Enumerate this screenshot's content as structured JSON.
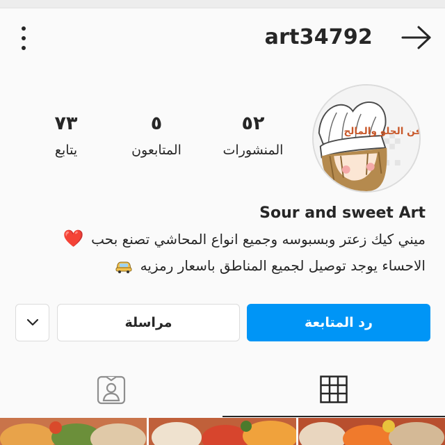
{
  "header": {
    "username": "art34792",
    "menu_icon": "more-vertical-icon",
    "back_icon": "arrow-right-icon"
  },
  "avatar": {
    "text": "فن الحلو والمالح"
  },
  "stats": {
    "posts": {
      "count": "٥٢",
      "label": "المنشورات"
    },
    "followers": {
      "count": "٥",
      "label": "المتابعون"
    },
    "following": {
      "count": "٧٣",
      "label": "يتابع"
    }
  },
  "bio": {
    "name": "Sour and sweet Art",
    "line1": "ميني كيك زعتر وبسبوسه وجميع انواع المحاشي تصنع بحب",
    "line1_emoji": "❤️",
    "line2": "الاحساء  يوجد توصيل لجميع المناطق باسعار رمزيه",
    "line2_emoji": "car-icon"
  },
  "actions": {
    "follow_back": "رد المتابعة",
    "message": "مراسلة",
    "dropdown_icon": "chevron-down-icon"
  },
  "tabs": [
    {
      "name": "posts-grid",
      "icon": "grid-icon",
      "active": true
    },
    {
      "name": "tagged",
      "icon": "tagged-user-icon",
      "active": false
    }
  ],
  "colors": {
    "accent": "#0095f6",
    "text": "#262626",
    "border": "#dbdbdb",
    "background": "#fafafa"
  }
}
